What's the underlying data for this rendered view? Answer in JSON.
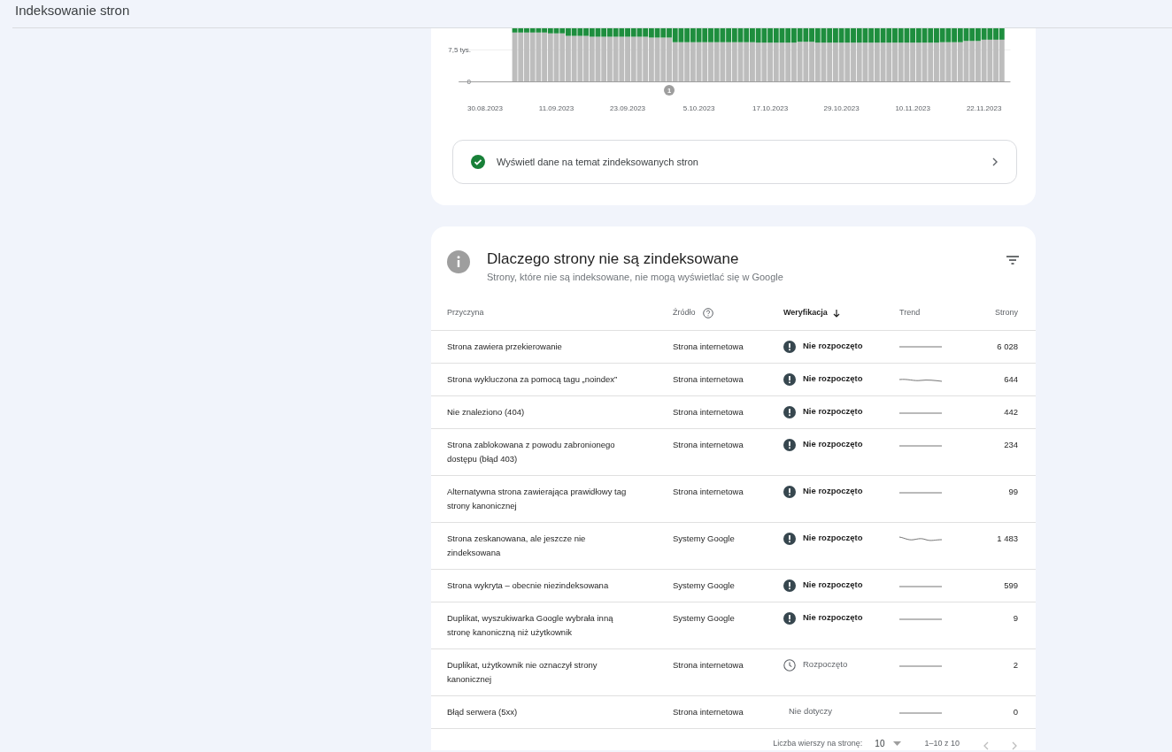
{
  "header": {
    "title": "Indeksowanie stron"
  },
  "chart_card": {
    "chart_data": {
      "type": "bar",
      "stacked": true,
      "ylim": [
        0,
        12.6
      ],
      "yticks": [
        {
          "value": 0,
          "label": "0"
        },
        {
          "value": 7.5,
          "label": "7,5 tys."
        }
      ],
      "categories": [
        null,
        null,
        null,
        null,
        "30.08.2023",
        null,
        null,
        null,
        null,
        null,
        null,
        null,
        null,
        null,
        null,
        null,
        "11.09.2023",
        null,
        null,
        null,
        null,
        null,
        null,
        null,
        null,
        null,
        null,
        null,
        "23.09.2023",
        null,
        null,
        null,
        null,
        null,
        null,
        null,
        null,
        null,
        null,
        null,
        "5.10.2023",
        null,
        null,
        null,
        null,
        null,
        null,
        null,
        null,
        null,
        null,
        null,
        "17.10.2023",
        null,
        null,
        null,
        null,
        null,
        null,
        null,
        null,
        null,
        null,
        null,
        "29.10.2023",
        null,
        null,
        null,
        null,
        null,
        null,
        null,
        null,
        null,
        null,
        null,
        "10.11.2023",
        null,
        null,
        null,
        null,
        null,
        null,
        null,
        null,
        null,
        null,
        null,
        "22.11.2023",
        null,
        null,
        null,
        null
      ],
      "series": [
        {
          "color": "#bdbdbd",
          "values": [
            null,
            null,
            null,
            null,
            null,
            null,
            null,
            null,
            null,
            11.6,
            11.6,
            11.6,
            11.6,
            11.6,
            11.6,
            11.4,
            11.4,
            11.4,
            10.8,
            10.8,
            10.8,
            10.8,
            10.6,
            10.6,
            10.6,
            10.6,
            10.6,
            10.6,
            10.6,
            10.6,
            10.6,
            10.6,
            10.4,
            10.4,
            10.4,
            10.4,
            9.3,
            9.3,
            9.3,
            9.3,
            9.3,
            9.3,
            9.3,
            9.3,
            9.3,
            9.3,
            9.3,
            9.3,
            9.3,
            9.3,
            9.2,
            9.2,
            9.2,
            9.2,
            9.2,
            9.2,
            9.2,
            9.4,
            9.4,
            9.4,
            9.2,
            9.2,
            9.2,
            9.2,
            9.2,
            9.2,
            9.2,
            9.2,
            9.2,
            9.2,
            9.2,
            9.2,
            9.2,
            9.2,
            9.2,
            9.2,
            9.2,
            9.2,
            9.2,
            9.2,
            9.2,
            9.3,
            9.3,
            9.3,
            9.3,
            9.6,
            9.6,
            9.6,
            9.9,
            9.9,
            9.9,
            9.9,
            null
          ]
        },
        {
          "color": "#1e8e3e",
          "values": [
            null,
            null,
            null,
            null,
            null,
            null,
            null,
            null,
            null,
            1.0,
            1.0,
            1.0,
            1.0,
            1.0,
            1.0,
            1.2,
            1.2,
            1.2,
            1.8,
            1.8,
            1.8,
            1.8,
            2.0,
            2.0,
            2.0,
            2.0,
            2.0,
            2.0,
            2.0,
            2.0,
            2.0,
            2.0,
            2.2,
            2.2,
            2.2,
            2.2,
            3.3,
            3.3,
            3.3,
            3.3,
            3.3,
            3.3,
            3.3,
            3.3,
            3.3,
            3.3,
            3.3,
            3.3,
            3.3,
            3.3,
            3.4,
            3.4,
            3.4,
            3.4,
            3.4,
            3.4,
            3.4,
            3.2,
            3.2,
            3.2,
            3.4,
            3.4,
            3.4,
            3.4,
            3.4,
            3.4,
            3.4,
            3.4,
            3.4,
            3.4,
            3.4,
            3.4,
            3.4,
            3.4,
            3.4,
            3.4,
            3.4,
            3.4,
            3.4,
            3.4,
            3.4,
            3.3,
            3.3,
            3.3,
            3.3,
            3.0,
            3.0,
            3.0,
            2.7,
            2.7,
            2.7,
            2.7,
            null
          ]
        }
      ],
      "annotations": [
        "1"
      ]
    },
    "link": {
      "label": "Wyświetl dane na temat zindeksowanych stron"
    }
  },
  "table_card": {
    "title": "Dlaczego strony nie są zindeksowane",
    "subtitle": "Strony, które nie są indeksowane, nie mogą wyświetlać się w Google",
    "columns": [
      "Przyczyna",
      "Źródło",
      "Weryfikacja",
      "Trend",
      "Strony"
    ],
    "rows": [
      {
        "reason": "Strona zawiera przekierowanie",
        "source": "Strona internetowa",
        "verification": {
          "kind": "not_started",
          "label": "Nie rozpoczęto"
        },
        "pages": "6 028"
      },
      {
        "reason": "Strona wykluczona za pomocą tagu „noindex”",
        "source": "Strona internetowa",
        "verification": {
          "kind": "not_started",
          "label": "Nie rozpoczęto"
        },
        "pages": "644"
      },
      {
        "reason": "Nie znaleziono (404)",
        "source": "Strona internetowa",
        "verification": {
          "kind": "not_started",
          "label": "Nie rozpoczęto"
        },
        "pages": "442"
      },
      {
        "reason": "Strona zablokowana z powodu zabronionego dostępu (błąd 403)",
        "source": "Strona internetowa",
        "verification": {
          "kind": "not_started",
          "label": "Nie rozpoczęto"
        },
        "pages": "234"
      },
      {
        "reason": "Alternatywna strona zawierająca prawidłowy tag strony kanonicznej",
        "source": "Strona internetowa",
        "verification": {
          "kind": "not_started",
          "label": "Nie rozpoczęto"
        },
        "pages": "99"
      },
      {
        "reason": "Strona zeskanowana, ale jeszcze nie zindeksowana",
        "source": "Systemy Google",
        "verification": {
          "kind": "not_started",
          "label": "Nie rozpoczęto"
        },
        "pages": "1 483"
      },
      {
        "reason": "Strona wykryta – obecnie niezindeksowana",
        "source": "Systemy Google",
        "verification": {
          "kind": "not_started",
          "label": "Nie rozpoczęto"
        },
        "pages": "599"
      },
      {
        "reason": "Duplikat, wyszukiwarka Google wybrała inną stronę kanoniczną niż użytkownik",
        "source": "Systemy Google",
        "verification": {
          "kind": "not_started",
          "label": "Nie rozpoczęto"
        },
        "pages": "9"
      },
      {
        "reason": "Duplikat, użytkownik nie oznaczył strony kanonicznej",
        "source": "Strona internetowa",
        "verification": {
          "kind": "started",
          "label": "Rozpoczęto"
        },
        "pages": "2"
      },
      {
        "reason": "Błąd serwera (5xx)",
        "source": "Strona internetowa",
        "verification": {
          "kind": "not_applicable",
          "label": "Nie dotyczy"
        },
        "pages": "0"
      }
    ],
    "pagination": {
      "rows_label": "Liczba wierszy na stronę:",
      "rows_value": "10",
      "range": "1–10 z 10"
    }
  }
}
